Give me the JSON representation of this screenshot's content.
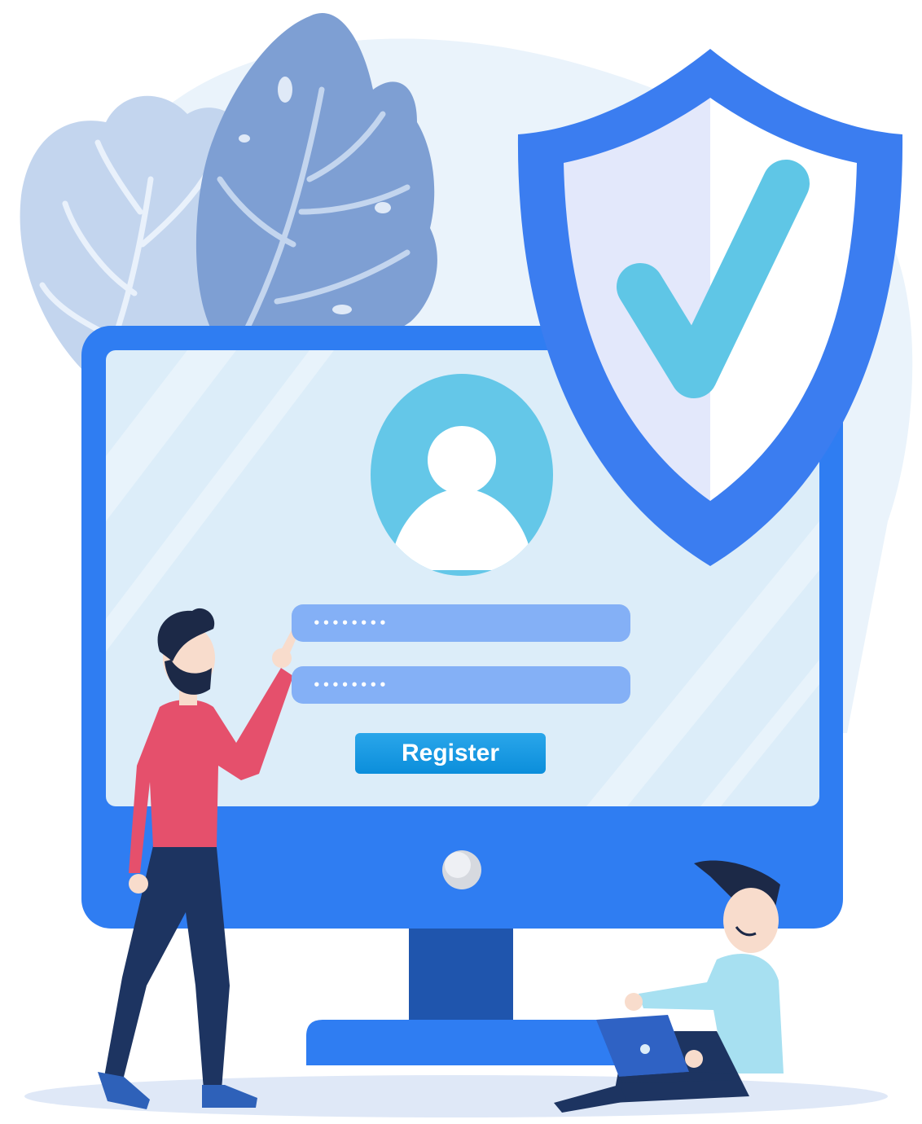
{
  "colors": {
    "background_blob": "#eaf3fb",
    "leaf_dark": "#7e9fd3",
    "leaf_light": "#c3d5ee",
    "leaf_vein": "#e9f1fb",
    "monitor_frame": "#2f7df2",
    "monitor_screen": "#dcedf9",
    "monitor_stand": "#1f55ad",
    "shield_outer": "#3b7df0",
    "shield_inner_left": "#e3e8fb",
    "shield_inner_right": "#ffffff",
    "checkmark": "#5fc6e6",
    "avatar_circle": "#64c7e8",
    "field_fill": "#84b0f6",
    "register_button": "#0b8edb",
    "register_button_light": "#2aa6ea",
    "person_shirt": "#e5506c",
    "person_pants": "#1d3461",
    "person_hair": "#1c2947",
    "person_skin": "#f8dccc",
    "sitting_shirt": "#a7e0f1",
    "ground_shadow": "#dfe8f7"
  },
  "icons": {
    "shield": "shield-check-icon",
    "avatar": "user-avatar-icon",
    "power": "power-button-icon",
    "laptop": "laptop-icon"
  },
  "login_form": {
    "username_field": {
      "value": "••••••••"
    },
    "password_field": {
      "value": "••••••••"
    },
    "register_label": "Register"
  }
}
